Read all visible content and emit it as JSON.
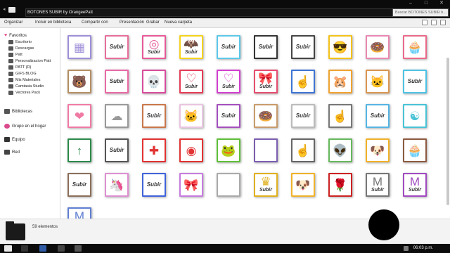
{
  "window": {
    "title": "BOTONES SUBIR by OrangeePatt",
    "search_placeholder": "Buscar BOTONES SUBIR b..."
  },
  "toolbar": {
    "items": [
      "Organizar",
      "Incluir en biblioteca",
      "Compartir con",
      "Presentación",
      "Grabar",
      "Nueva carpeta"
    ]
  },
  "sidebar": {
    "favorites_label": "Favoritos",
    "favorites": [
      "Escritorio",
      "Descargas",
      "Patt",
      "Personalizacion Patt",
      "PATT (D)",
      "GIFS BLOG",
      "Mis Materiales",
      "Camtasia Studio",
      "Vectores Pack"
    ],
    "libraries_label": "Bibliotecas",
    "homegroup_label": "Grupo en el hogar",
    "computer_label": "Equipo",
    "network_label": "Red"
  },
  "content": {
    "tiles": [
      {
        "kind": "pattern",
        "glyph": "▦",
        "color": "#9f8fd8",
        "caption": ""
      },
      {
        "kind": "badge",
        "glyph": "",
        "color": "#e76f9b",
        "caption": "Subir"
      },
      {
        "kind": "badge",
        "glyph": "◎",
        "color": "#e65a98",
        "caption": "Subir"
      },
      {
        "kind": "badge",
        "glyph": "🦇",
        "color": "#f5d21f",
        "caption": "Subir"
      },
      {
        "kind": "badge",
        "glyph": "",
        "color": "#5cc8e8",
        "caption": "Subir"
      },
      {
        "kind": "badge",
        "glyph": "",
        "color": "#333333",
        "caption": "Subir"
      },
      {
        "kind": "badge",
        "glyph": "",
        "color": "#444444",
        "caption": "Subir"
      },
      {
        "kind": "badge",
        "glyph": "😎",
        "color": "#f3c21a",
        "caption": ""
      },
      {
        "kind": "badge",
        "glyph": "🍩",
        "color": "#e889b3",
        "caption": ""
      },
      {
        "kind": "badge",
        "glyph": "🧁",
        "color": "#e96a8a",
        "caption": ""
      },
      {
        "kind": "badge",
        "glyph": "🐻",
        "color": "#b58f63",
        "caption": ""
      },
      {
        "kind": "badge",
        "glyph": "",
        "color": "#e86aa5",
        "caption": "Subir"
      },
      {
        "kind": "badge",
        "glyph": "💀",
        "color": "#d74d9b",
        "caption": ""
      },
      {
        "kind": "badge",
        "glyph": "♡",
        "color": "#e53c57",
        "caption": "Subir"
      },
      {
        "kind": "badge",
        "glyph": "♡",
        "color": "#d13fcf",
        "caption": "Subir"
      },
      {
        "kind": "badge",
        "glyph": "🎀",
        "color": "#e44d6f",
        "caption": "Subir"
      },
      {
        "kind": "badge",
        "glyph": "☝",
        "color": "#3d74d4",
        "caption": ""
      },
      {
        "kind": "badge",
        "glyph": "🐹",
        "color": "#f0a332",
        "caption": ""
      },
      {
        "kind": "badge",
        "glyph": "🐱",
        "color": "#d99653",
        "caption": ""
      },
      {
        "kind": "badge",
        "glyph": "",
        "color": "#4ec2e3",
        "caption": "Subir"
      },
      {
        "kind": "badge",
        "glyph": "❤",
        "color": "#ef7aa4",
        "caption": ""
      },
      {
        "kind": "badge",
        "glyph": "☁",
        "color": "#999999",
        "caption": ""
      },
      {
        "kind": "badge",
        "glyph": "",
        "color": "#c9774b",
        "caption": "Subir"
      },
      {
        "kind": "badge",
        "glyph": "🐱",
        "color": "#e9c5e0",
        "caption": ""
      },
      {
        "kind": "badge",
        "glyph": "",
        "color": "#a44fbd",
        "caption": "Subir"
      },
      {
        "kind": "badge",
        "glyph": "🍩",
        "color": "#c89b6c",
        "caption": ""
      },
      {
        "kind": "badge",
        "glyph": "",
        "color": "#bbbbbb",
        "caption": "Subir"
      },
      {
        "kind": "badge",
        "glyph": "☝",
        "color": "#777777",
        "caption": ""
      },
      {
        "kind": "badge",
        "glyph": "",
        "color": "#56b5e3",
        "caption": "Subir"
      },
      {
        "kind": "badge",
        "glyph": "☯",
        "color": "#49c3d6",
        "caption": ""
      },
      {
        "kind": "badge",
        "glyph": "↑",
        "color": "#2c8a4b",
        "caption": ""
      },
      {
        "kind": "badge",
        "glyph": "",
        "color": "#555555",
        "caption": "Subir"
      },
      {
        "kind": "badge",
        "glyph": "✚",
        "color": "#e23232",
        "caption": ""
      },
      {
        "kind": "badge",
        "glyph": "◉",
        "color": "#e23232",
        "caption": ""
      },
      {
        "kind": "badge",
        "glyph": "🐸",
        "color": "#5fbf3a",
        "caption": ""
      },
      {
        "kind": "badge",
        "glyph": "",
        "color": "#7b5eb0",
        "caption": ""
      },
      {
        "kind": "badge",
        "glyph": "☝",
        "color": "#666666",
        "caption": ""
      },
      {
        "kind": "badge",
        "glyph": "👽",
        "color": "#66b85c",
        "caption": ""
      },
      {
        "kind": "badge",
        "glyph": "🐶",
        "color": "#f0b22a",
        "caption": ""
      },
      {
        "kind": "badge",
        "glyph": "🧁",
        "color": "#8d5a3f",
        "caption": ""
      },
      {
        "kind": "badge",
        "glyph": "",
        "color": "#8b6f5a",
        "caption": "Subir"
      },
      {
        "kind": "badge",
        "glyph": "🦄",
        "color": "#dd8fd2",
        "caption": ""
      },
      {
        "kind": "badge",
        "glyph": "",
        "color": "#3f63d9",
        "caption": "Subir"
      },
      {
        "kind": "badge",
        "glyph": "🎀",
        "color": "#c77be0",
        "caption": ""
      },
      {
        "kind": "badge",
        "glyph": "",
        "color": "#aaaaaa",
        "caption": ""
      },
      {
        "kind": "badge",
        "glyph": "♛",
        "color": "#e0b120",
        "caption": "Subir"
      },
      {
        "kind": "badge",
        "glyph": "🐶",
        "color": "#f0b22a",
        "caption": ""
      },
      {
        "kind": "badge",
        "glyph": "🌹",
        "color": "#cc2222",
        "caption": ""
      },
      {
        "kind": "badge",
        "glyph": "M",
        "color": "#777777",
        "caption": "Subir"
      },
      {
        "kind": "badge",
        "glyph": "M",
        "color": "#a04abf",
        "caption": "Subir"
      },
      {
        "kind": "badge",
        "glyph": "M",
        "color": "#5f7fd2",
        "caption": "Subir"
      }
    ]
  },
  "status": {
    "count_text": "59 elementos"
  },
  "taskbar": {
    "time": "06:03 p.m."
  }
}
